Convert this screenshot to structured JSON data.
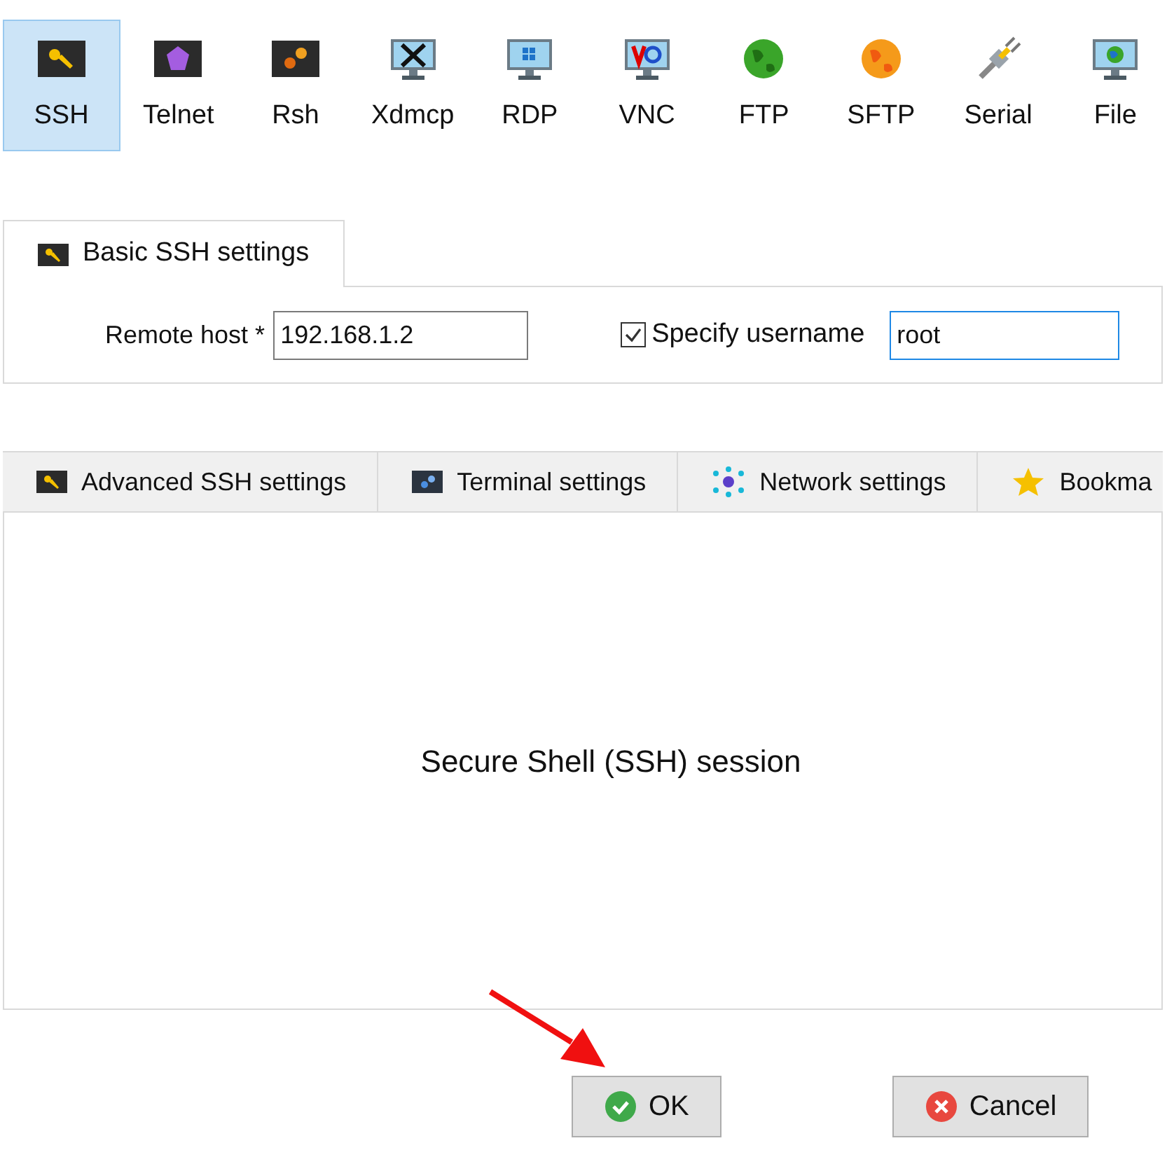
{
  "session_types": [
    {
      "label": "SSH",
      "kind": "ssh",
      "selected": true
    },
    {
      "label": "Telnet",
      "kind": "telnet",
      "selected": false
    },
    {
      "label": "Rsh",
      "kind": "rsh",
      "selected": false
    },
    {
      "label": "Xdmcp",
      "kind": "xdmcp",
      "selected": false
    },
    {
      "label": "RDP",
      "kind": "rdp",
      "selected": false
    },
    {
      "label": "VNC",
      "kind": "vnc",
      "selected": false
    },
    {
      "label": "FTP",
      "kind": "ftp",
      "selected": false
    },
    {
      "label": "SFTP",
      "kind": "sftp",
      "selected": false
    },
    {
      "label": "Serial",
      "kind": "serial",
      "selected": false
    },
    {
      "label": "File",
      "kind": "file",
      "selected": false
    }
  ],
  "basic_tab": {
    "label": "Basic SSH settings",
    "selected": true
  },
  "remote_host": {
    "label": "Remote host *",
    "value": "192.168.1.2"
  },
  "specify_username": {
    "label": "Specify username",
    "checked": true,
    "value": "root"
  },
  "settings_tabs": [
    {
      "label": "Advanced SSH settings",
      "kind": "key",
      "selected": false
    },
    {
      "label": "Terminal settings",
      "kind": "terminal",
      "selected": false
    },
    {
      "label": "Network settings",
      "kind": "network",
      "selected": false
    },
    {
      "label": "Bookma",
      "kind": "star",
      "selected": false
    }
  ],
  "session_description": "Secure Shell (SSH) session",
  "buttons": [
    {
      "label": "OK",
      "kind": "ok"
    },
    {
      "label": "Cancel",
      "kind": "cancel"
    }
  ]
}
